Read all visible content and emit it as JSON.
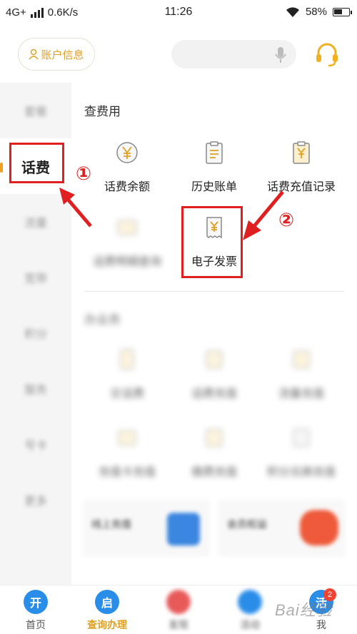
{
  "status_bar": {
    "network": "4G+",
    "speed": "0.6K/s",
    "time": "11:26",
    "battery": "58%",
    "icons": [
      "signal-icon",
      "wifi-icon",
      "battery-icon"
    ]
  },
  "header": {
    "account_label": "账户信息",
    "search_placeholder": "",
    "icons": [
      "user-icon",
      "microphone-icon",
      "headset-icon"
    ]
  },
  "sidebar": {
    "items": [
      {
        "label": "套餐",
        "active": false
      },
      {
        "label": "话费",
        "active": true
      },
      {
        "label": "流量",
        "active": false
      },
      {
        "label": "宽带",
        "active": false
      },
      {
        "label": "积分",
        "active": false
      },
      {
        "label": "服务",
        "active": false
      },
      {
        "label": "号卡",
        "active": false
      },
      {
        "label": "更多",
        "active": false
      }
    ]
  },
  "content": {
    "query_section_title": "查费用",
    "query_items": [
      {
        "label": "话费余额",
        "icon": "yen-circle-icon"
      },
      {
        "label": "历史账单",
        "icon": "clipboard-icon"
      },
      {
        "label": "话费充值记录",
        "icon": "recharge-record-icon"
      },
      {
        "label": "话费明细查询",
        "icon": "detail-icon"
      },
      {
        "label": "电子发票",
        "icon": "invoice-icon"
      }
    ],
    "handle_section_title": "办业务",
    "handle_items": [
      {
        "label": "交话费"
      },
      {
        "label": "话费充值"
      },
      {
        "label": "流量充值"
      },
      {
        "label": "充值卡充值"
      },
      {
        "label": "缴费充值"
      },
      {
        "label": "积分兑换充值"
      }
    ],
    "promos": [
      {
        "title": "线上充值"
      },
      {
        "title": "会员权益"
      }
    ]
  },
  "annotations": {
    "marker_1": "①",
    "marker_2": "②"
  },
  "tabbar": {
    "tabs": [
      {
        "label": "首页",
        "glyph": "开",
        "color": "#2a8de8"
      },
      {
        "label": "查询办理",
        "glyph": "启",
        "color": "#2a8de8"
      },
      {
        "label": "发现",
        "glyph": "",
        "color": "#e85a5a"
      },
      {
        "label": "活动",
        "glyph": "",
        "color": "#2a8de8"
      },
      {
        "label": "我",
        "glyph": "活",
        "color": "#2a8de8"
      }
    ],
    "badge_count": "2",
    "active_color": "#e0a020"
  },
  "watermark": "Bai经验"
}
